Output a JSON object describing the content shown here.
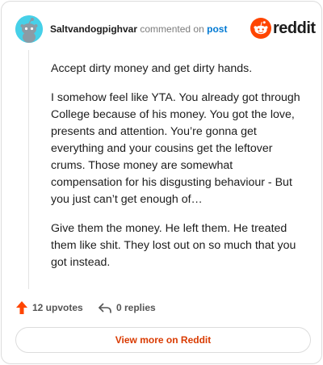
{
  "header": {
    "username": "Saltvandogpighvar",
    "action_text": "commented on",
    "post_link": "post",
    "logo_text": "reddit"
  },
  "comment": {
    "paragraphs": [
      "Accept dirty money and get dirty hands.",
      "I somehow feel like YTA. You already got through College because of his money. You got the love, presents and attention. You’re gonna get everything and your cousins get the leftover crums. Those money are somewhat compensation for his disgusting behaviour - But you just can’t get enough of…",
      "Give them the money. He left them. He treated them like shit. They lost out on so much that you got instead."
    ]
  },
  "actions": {
    "upvotes": "12 upvotes",
    "replies": "0 replies"
  },
  "footer": {
    "view_more": "View more on Reddit"
  },
  "colors": {
    "brand_orange": "#ff4500",
    "link_blue": "#0079d3",
    "view_more_text": "#d93a00",
    "avatar_bg": "#46d0e8"
  },
  "icons": [
    "snoo-avatar-icon",
    "reddit-logo-icon",
    "upvote-arrow-icon",
    "reply-arrow-icon"
  ]
}
